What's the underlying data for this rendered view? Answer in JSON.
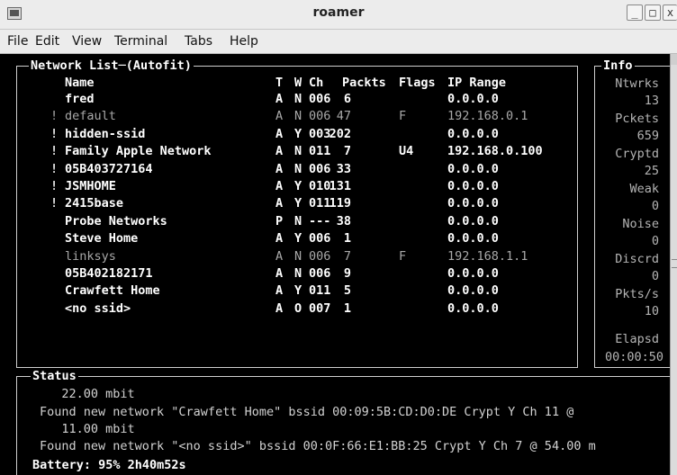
{
  "window": {
    "title": "roamer"
  },
  "menu": [
    "File",
    "Edit",
    "View",
    "Terminal",
    "Tabs",
    "Help"
  ],
  "network_list": {
    "title": "Network List",
    "mode": "(Autofit)",
    "columns": {
      "name": "Name",
      "t": "T",
      "w": "W",
      "ch": "Ch",
      "packets": "Packts",
      "flags": "Flags",
      "ip": "IP Range"
    },
    "rows": [
      {
        "marker": "",
        "name": "fred",
        "t": "A",
        "w": "N",
        "ch": "006",
        "packets": "6",
        "flags": "",
        "ip": "0.0.0.0",
        "dim": false
      },
      {
        "marker": "!",
        "name": "default",
        "t": "A",
        "w": "N",
        "ch": "006",
        "packets": "47",
        "flags": "F",
        "ip": "192.168.0.1",
        "dim": true
      },
      {
        "marker": "!",
        "name": "hidden-ssid",
        "t": "A",
        "w": "Y",
        "ch": "003",
        "packets": "202",
        "flags": "",
        "ip": "0.0.0.0",
        "dim": false
      },
      {
        "marker": "!",
        "name": "Family Apple Network",
        "t": "A",
        "w": "N",
        "ch": "011",
        "packets": "7",
        "flags": "U4",
        "ip": "192.168.0.100",
        "dim": false
      },
      {
        "marker": "!",
        "name": "05B403727164",
        "t": "A",
        "w": "N",
        "ch": "006",
        "packets": "33",
        "flags": "",
        "ip": "0.0.0.0",
        "dim": false
      },
      {
        "marker": "!",
        "name": "JSMHOME",
        "t": "A",
        "w": "Y",
        "ch": "010",
        "packets": "131",
        "flags": "",
        "ip": "0.0.0.0",
        "dim": false
      },
      {
        "marker": "!",
        "name": "2415base",
        "t": "A",
        "w": "Y",
        "ch": "011",
        "packets": "119",
        "flags": "",
        "ip": "0.0.0.0",
        "dim": false
      },
      {
        "marker": "",
        "name": "Probe Networks",
        "t": "P",
        "w": "N",
        "ch": "---",
        "packets": "38",
        "flags": "",
        "ip": "0.0.0.0",
        "dim": false
      },
      {
        "marker": "",
        "name": "Steve Home",
        "t": "A",
        "w": "Y",
        "ch": "006",
        "packets": "1",
        "flags": "",
        "ip": "0.0.0.0",
        "dim": false
      },
      {
        "marker": "",
        "name": "linksys",
        "t": "A",
        "w": "N",
        "ch": "006",
        "packets": "7",
        "flags": "F",
        "ip": "192.168.1.1",
        "dim": true
      },
      {
        "marker": "",
        "name": "05B402182171",
        "t": "A",
        "w": "N",
        "ch": "006",
        "packets": "9",
        "flags": "",
        "ip": "0.0.0.0",
        "dim": false
      },
      {
        "marker": "",
        "name": "Crawfett Home",
        "t": "A",
        "w": "Y",
        "ch": "011",
        "packets": "5",
        "flags": "",
        "ip": "0.0.0.0",
        "dim": false
      },
      {
        "marker": "",
        "name": "<no ssid>",
        "t": "A",
        "w": "O",
        "ch": "007",
        "packets": "1",
        "flags": "",
        "ip": "0.0.0.0",
        "dim": false
      }
    ]
  },
  "info": {
    "title": "Info",
    "items": [
      {
        "label": "Ntwrks",
        "value": "13"
      },
      {
        "label": "Pckets",
        "value": "659"
      },
      {
        "label": "Cryptd",
        "value": "25"
      },
      {
        "label": "Weak",
        "value": "0"
      },
      {
        "label": "Noise",
        "value": "0"
      },
      {
        "label": "Discrd",
        "value": "0"
      },
      {
        "label": "Pkts/s",
        "value": "10"
      }
    ],
    "elapsed_label": "Elapsd",
    "elapsed_value": "00:00:50"
  },
  "status": {
    "title": "Status",
    "lines": [
      "   22.00 mbit",
      "Found new network \"Crawfett Home\" bssid 00:09:5B:CD:D0:DE Crypt Y Ch 11 @",
      "   11.00 mbit",
      "Found new network \"<no ssid>\" bssid 00:0F:66:E1:BB:25 Crypt Y Ch 7 @ 54.00 m"
    ],
    "battery": "Battery: 95% 2h40m52s"
  }
}
